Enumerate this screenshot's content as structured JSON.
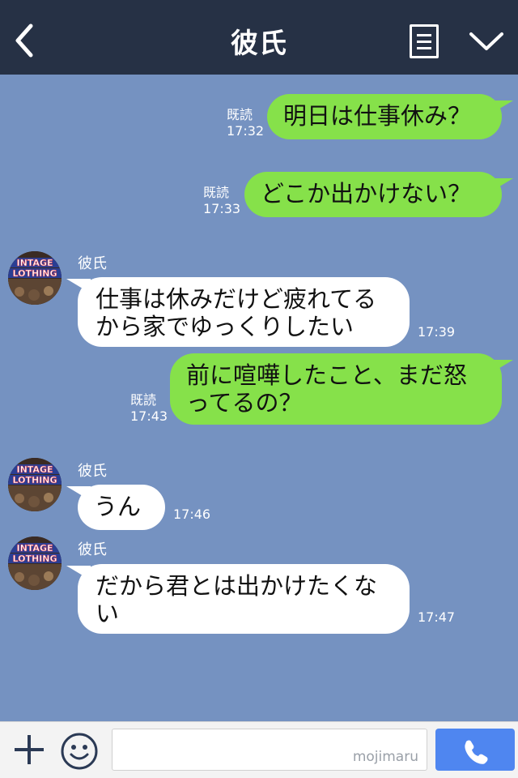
{
  "header": {
    "title": "彼氏"
  },
  "messages": [
    {
      "read": "既読",
      "time": "17:32",
      "text": "明日は仕事休み？"
    },
    {
      "read": "既読",
      "time": "17:33",
      "text": "どこか出かけない？"
    },
    {
      "name": "彼氏",
      "time": "17:39",
      "line1": "仕事は休みだけど疲れてる",
      "line2": "から家でゆっくりしたい"
    },
    {
      "read": "既読",
      "time": "17:43",
      "line1": "前に喧嘩したこと、まだ怒",
      "line2": "ってるの？"
    },
    {
      "name": "彼氏",
      "time": "17:46",
      "text": "うん"
    },
    {
      "name": "彼氏",
      "time": "17:47",
      "line1": "だから君とは出かけたくな",
      "line2": "い"
    }
  ],
  "avatar": {
    "line1": "INTAGE",
    "line2": "LOTHING"
  },
  "footer": {
    "placeholder": "mojimaru"
  }
}
